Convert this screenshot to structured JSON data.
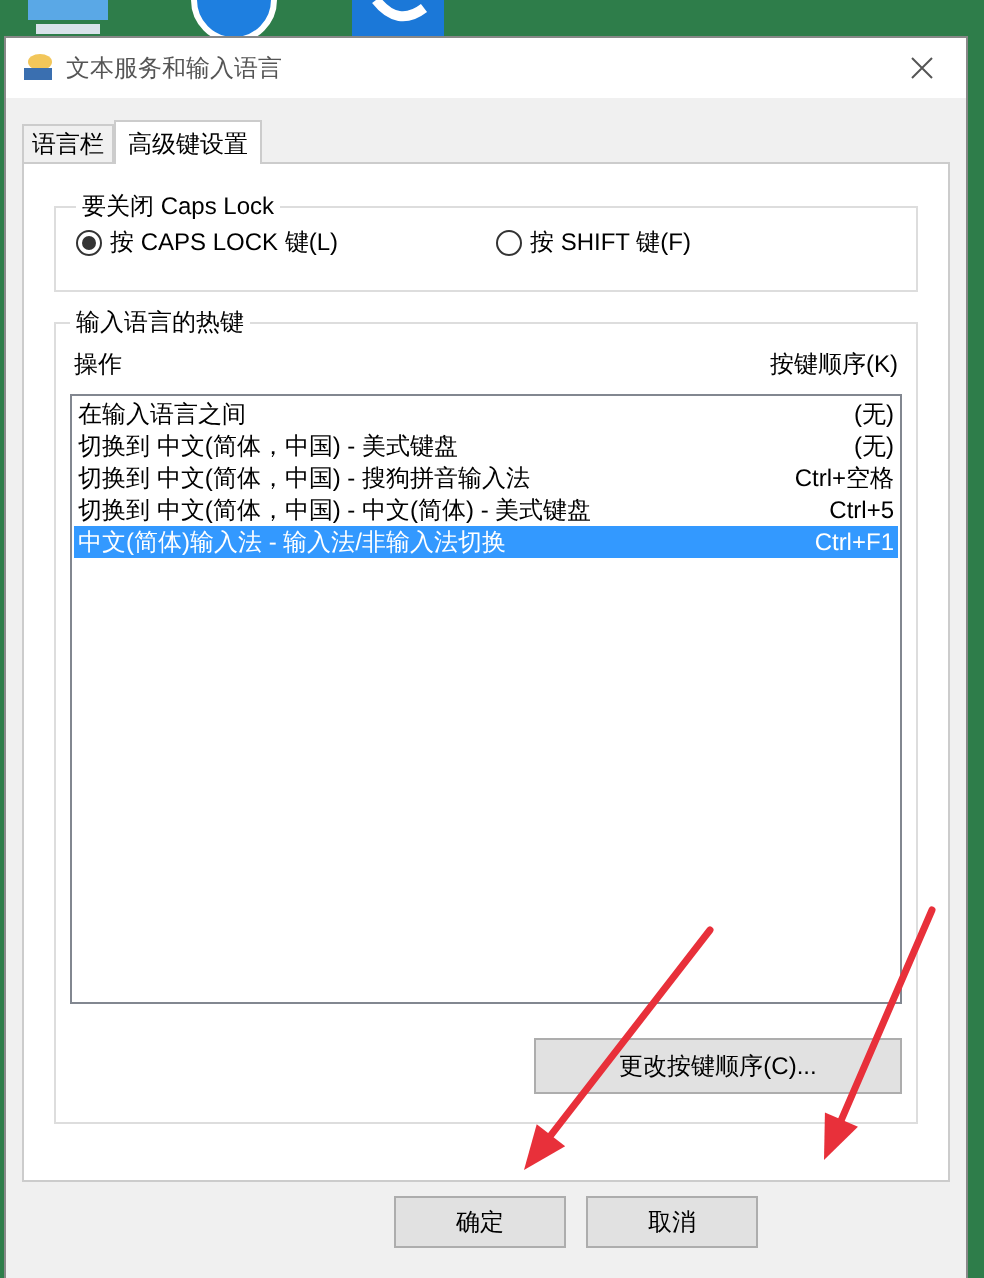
{
  "window": {
    "title": "文本服务和输入语言"
  },
  "tabs": [
    {
      "label": "语言栏",
      "selected": false
    },
    {
      "label": "高级键设置",
      "selected": true
    }
  ],
  "caps_lock": {
    "title": "要关闭 Caps Lock",
    "options": [
      {
        "label": "按 CAPS LOCK 键(L)",
        "selected": true
      },
      {
        "label": "按 SHIFT 键(F)",
        "selected": false
      }
    ]
  },
  "hotkeys": {
    "title": "输入语言的热键",
    "columns": [
      "操作",
      "按键顺序(K)"
    ],
    "rows": [
      {
        "action": "在输入语言之间",
        "keys": "(无)",
        "selected": false
      },
      {
        "action": "切换到 中文(简体，中国) - 美式键盘",
        "keys": "(无)",
        "selected": false
      },
      {
        "action": "切换到 中文(简体，中国) - 搜狗拼音输入法",
        "keys": "Ctrl+空格",
        "selected": false
      },
      {
        "action": "切换到 中文(简体，中国) - 中文(简体) - 美式键盘",
        "keys": "Ctrl+5",
        "selected": false
      },
      {
        "action": "中文(简体)输入法 - 输入法/非输入法切换",
        "keys": "Ctrl+F1",
        "selected": true
      }
    ],
    "button": "更改按键顺序(C)..."
  },
  "buttons": [
    "确定",
    "取消"
  ]
}
